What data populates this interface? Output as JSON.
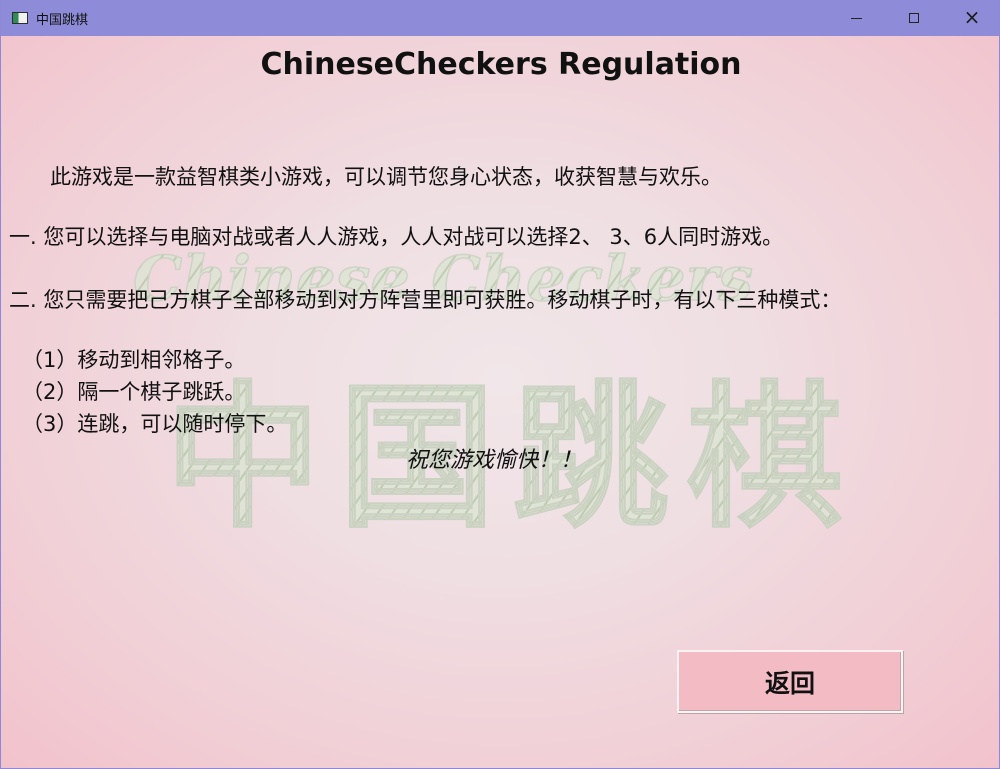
{
  "window": {
    "title": "中国跳棋",
    "app_icon": "checkerboard-app-icon",
    "controls": {
      "minimize_icon": "minimize-icon",
      "maximize_icon": "maximize-icon",
      "close_icon": "close-icon",
      "close_glyph": "×"
    }
  },
  "page": {
    "heading": "ChineseCheckers Regulation",
    "intro": "此游戏是一款益智棋类小游戏，可以调节您身心状态，收获智慧与欢乐。",
    "rules": [
      "一. 您可以选择与电脑对战或者人人游戏，人人对战可以选择2、 3、6人同时游戏。",
      "二. 您只需要把己方棋子全部移动到对方阵营里即可获胜。移动棋子时，有以下三种模式："
    ],
    "modes": [
      "（1）移动到相邻格子。",
      "（2）隔一个棋子跳跃。",
      "（3）连跳，可以随时停下。"
    ],
    "wish": "祝您游戏愉快！！",
    "back_button": "返回"
  },
  "watermark": {
    "english": "Chinese Checkers",
    "chinese": "中国跳棋"
  },
  "colors": {
    "titlebar": "#8e8cd8",
    "background": "#f3c8cf",
    "button": "#f3bcc5",
    "watermark": "#c9d6bf"
  }
}
